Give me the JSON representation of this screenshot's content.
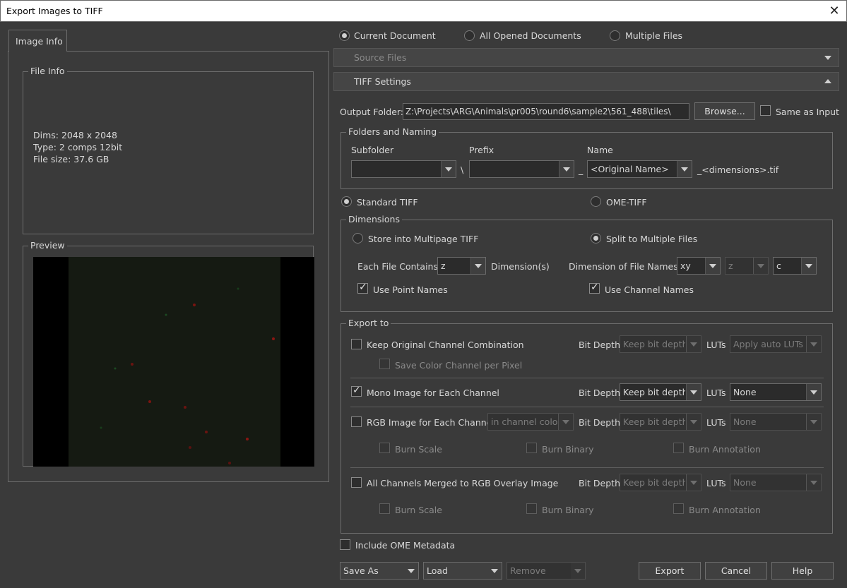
{
  "window": {
    "title": "Export Images to TIFF"
  },
  "left": {
    "tab": "Image Info",
    "file_info": {
      "legend": "File Info",
      "dims": "Dims: 2048 x 2048",
      "type": "Type: 2 comps 12bit",
      "size": "File size: 37.6 GB"
    },
    "preview_legend": "Preview"
  },
  "source": {
    "options": [
      "Current Document",
      "All Opened Documents",
      "Multiple Files"
    ],
    "selected": "Current Document"
  },
  "sections": {
    "source_files": "Source Files",
    "tiff_settings": "TIFF Settings"
  },
  "output": {
    "label": "Output Folder:",
    "value": "Z:\\Projects\\ARG\\Animals\\pr005\\round6\\sample2\\561_488\\tiles\\",
    "browse": "Browse...",
    "same_as_input": "Same as Input"
  },
  "naming": {
    "legend": "Folders and Naming",
    "subfolder_label": "Subfolder",
    "subfolder_value": "",
    "prefix_label": "Prefix",
    "prefix_value": "",
    "name_label": "Name",
    "name_value": "<Original Name>",
    "sep1": "\\",
    "sep2": "_",
    "suffix": "_<dimensions>.tif"
  },
  "format": {
    "standard": "Standard TIFF",
    "ome": "OME-TIFF",
    "selected": "Standard TIFF"
  },
  "dimensions": {
    "legend": "Dimensions",
    "store_multipage": "Store into Multipage TIFF",
    "split_files": "Split to Multiple Files",
    "each_file_label": "Each File Contains:",
    "each_file_value": "z",
    "dims_suffix": "Dimension(s)",
    "dim_names_label": "Dimension of File Names:",
    "dim_names": [
      "xy",
      "z",
      "c"
    ],
    "use_point_names": "Use Point Names",
    "use_channel_names": "Use Channel Names"
  },
  "export_to": {
    "legend": "Export to",
    "bit_depth_label": "Bit Depth",
    "luts_label": "LUTs",
    "keep_original": {
      "label": "Keep Original Channel Combination",
      "checked": false,
      "bit_depth": "Keep bit depth",
      "luts": "Apply auto LUTs"
    },
    "save_color_per_pixel": "Save Color Channel per Pixel",
    "mono": {
      "label": "Mono Image for Each Channel",
      "checked": true,
      "bit_depth": "Keep bit depth",
      "luts": "None"
    },
    "rgb": {
      "label": "RGB Image for Each Channel",
      "checked": false,
      "color": "in channel color",
      "bit_depth": "Keep bit depth",
      "luts": "None"
    },
    "merged": {
      "label": "All Channels Merged to RGB Overlay Image",
      "checked": false,
      "bit_depth": "Keep bit depth",
      "luts": "None"
    },
    "burn_scale": "Burn Scale",
    "burn_binary": "Burn Binary",
    "burn_annotation": "Burn Annotation"
  },
  "include_ome": "Include OME Metadata",
  "footer": {
    "save_as": "Save As",
    "load": "Load",
    "remove": "Remove",
    "export": "Export",
    "cancel": "Cancel",
    "help": "Help"
  },
  "colors": {
    "background": "#3a3a3a",
    "field": "#2b2b2b",
    "border": "#6d6d6d",
    "text": "#d8d8d8"
  }
}
